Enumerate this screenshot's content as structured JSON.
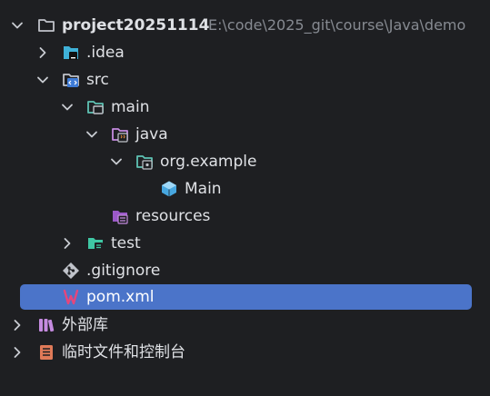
{
  "tree": {
    "root": {
      "label": "project20251114",
      "path": "E:\\code\\2025_git\\course\\Java\\demo"
    },
    "idea": {
      "label": ".idea"
    },
    "src": {
      "label": "src"
    },
    "main": {
      "label": "main"
    },
    "java": {
      "label": "java"
    },
    "package": {
      "label": "org.example"
    },
    "main_class": {
      "label": "Main"
    },
    "resources": {
      "label": "resources"
    },
    "test": {
      "label": "test"
    },
    "gitignore": {
      "label": ".gitignore"
    },
    "pom": {
      "label": "pom.xml"
    },
    "external_libraries": {
      "label": "外部库"
    },
    "scratches": {
      "label": "临时文件和控制台"
    }
  }
}
